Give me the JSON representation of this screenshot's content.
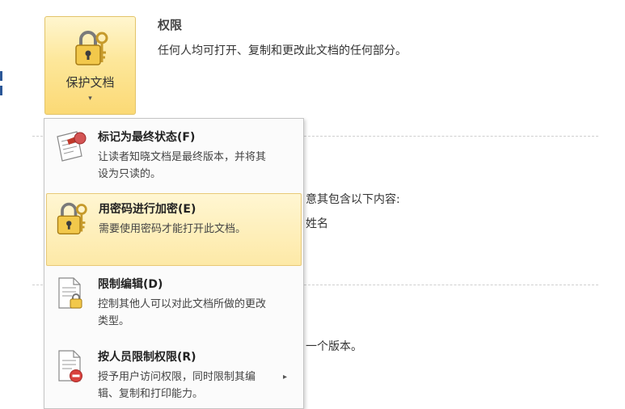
{
  "protect_button": {
    "label": "保护文档",
    "caret": "▾"
  },
  "permissions": {
    "title": "权限",
    "description": "任何人均可打开、复制和更改此文档的任何部分。"
  },
  "background_text": {
    "line1": "意其包含以下内容:",
    "line2": "姓名",
    "line3": "一个版本。"
  },
  "menu": {
    "items": [
      {
        "title": "标记为最终状态(F)",
        "desc": "让读者知晓文档是最终版本，并将其设为只读的。",
        "icon": "document-ribbon-icon"
      },
      {
        "title": "用密码进行加密(E)",
        "desc": "需要使用密码才能打开此文档。",
        "icon": "lock-key-icon"
      },
      {
        "title": "限制编辑(D)",
        "desc": "控制其他人可以对此文档所做的更改类型。",
        "icon": "document-lock-icon"
      },
      {
        "title": "按人员限制权限(R)",
        "desc": "授予用户访问权限，同时限制其编辑、复制和打印能力。",
        "icon": "document-restrict-icon",
        "submenu_arrow": "▸"
      }
    ]
  },
  "colors": {
    "highlight": "#fde9a7",
    "highlight_border": "#e8c977",
    "accent_blue": "#2b5797"
  }
}
